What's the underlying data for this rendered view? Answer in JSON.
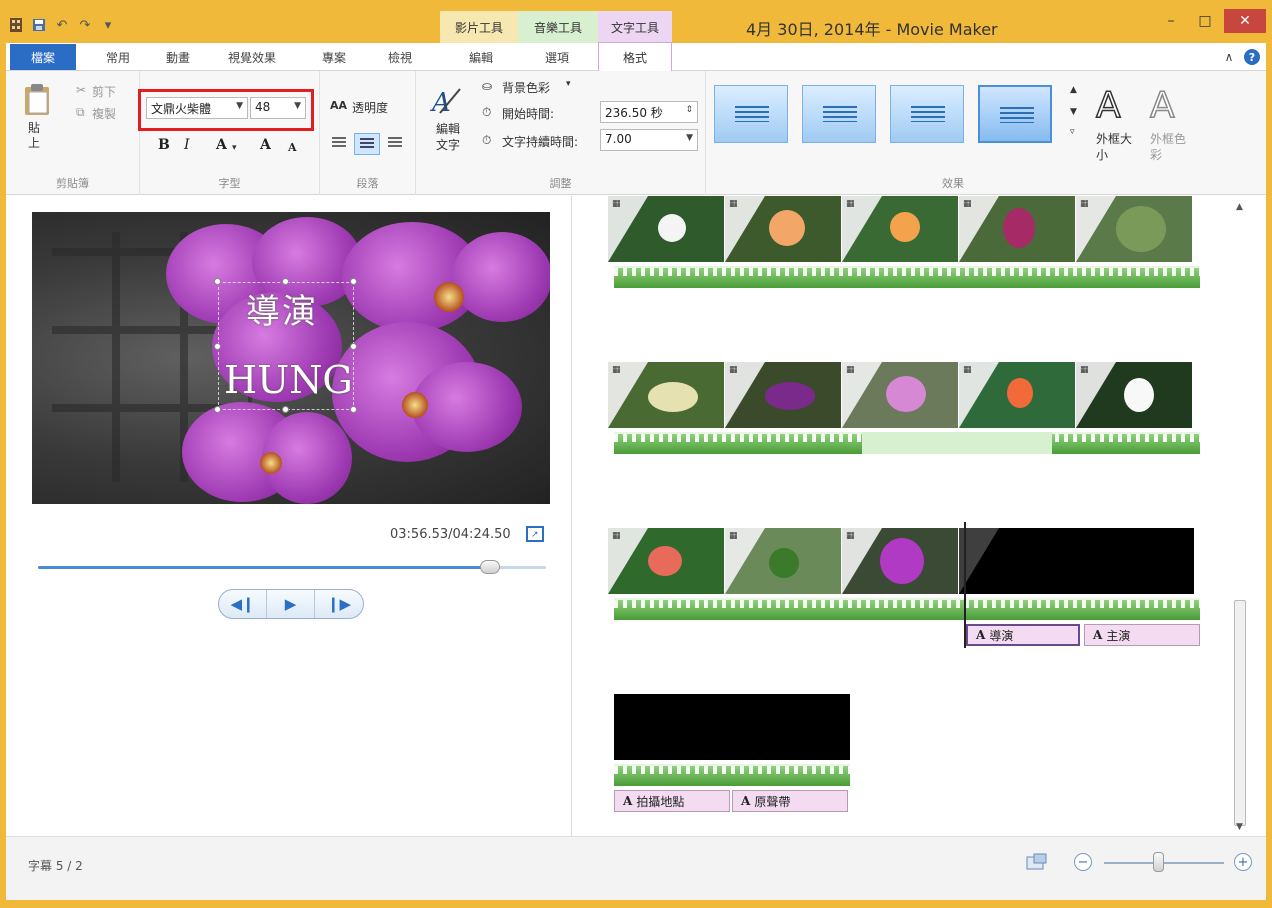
{
  "window": {
    "title": "4月 30日, 2014年 - Movie Maker",
    "accent": "#f0b93a",
    "controls": {
      "minimize": "–",
      "maximize": "□",
      "close": "✕"
    }
  },
  "context_tabs": [
    {
      "label": "影片工具",
      "color": "#f6e8b0"
    },
    {
      "label": "音樂工具",
      "color": "#d9f0d0"
    },
    {
      "label": "文字工具",
      "color": "#ecd6f2"
    }
  ],
  "tabs": [
    "檔案",
    "常用",
    "動畫",
    "視覺效果",
    "專案",
    "檢視",
    "編輯",
    "選項",
    "格式"
  ],
  "active_tab": "格式",
  "ribbon": {
    "clipboard": {
      "paste": "貼上",
      "cut": "剪下",
      "copy": "複製",
      "group": "剪貼簿"
    },
    "font": {
      "family": "文鼎火柴體",
      "size": "48",
      "bold": "B",
      "italic": "I",
      "color": "A",
      "grow": "A",
      "shrink": "A",
      "group": "字型"
    },
    "paragraph": {
      "transparency": "透明度",
      "group": "段落"
    },
    "adjust": {
      "edit_text": "編輯文字",
      "bg_color": "背景色彩",
      "start_time_label": "開始時間:",
      "start_time_value": "236.50 秒",
      "duration_label": "文字持續時間:",
      "duration_value": "7.00",
      "group": "調整"
    },
    "effects": {
      "group": "效果",
      "outline_size": "外框大小",
      "outline_color": "外框色彩",
      "selected_index": 3
    }
  },
  "preview": {
    "overlay_line1": "導演",
    "overlay_line2": "HUNG",
    "timecode": "03:56.53/04:24.50",
    "progress": 0.89
  },
  "storyboard": {
    "captions": [
      "導演",
      "主演",
      "拍攝地點",
      "原聲帶"
    ]
  },
  "status": {
    "text": "字幕 5 / 2",
    "zoom": 0.45
  }
}
